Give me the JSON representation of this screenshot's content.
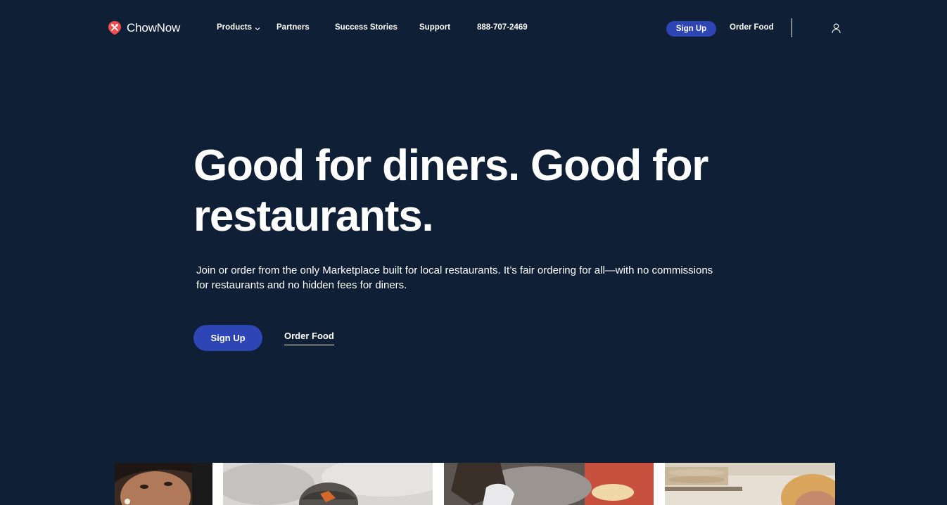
{
  "brand": {
    "name": "ChowNow",
    "accent": "#ef4e4e",
    "primary_button": "#2e45b5",
    "background": "#0f1f35"
  },
  "nav": {
    "products": "Products",
    "partners": "Partners",
    "success_stories": "Success Stories",
    "support": "Support",
    "phone": "888-707-2469",
    "sign_up": "Sign Up",
    "order_food": "Order Food",
    "icons": [
      "chevron-down-icon",
      "user-icon"
    ]
  },
  "hero": {
    "title": "Good for diners. Good for restaurants.",
    "subtitle": "Join or order from the only Marketplace built for local restaurants. It’s fair ordering for all—with no commissions for restaurants and no hidden fees for diners.",
    "sign_up": "Sign Up",
    "order_food": "Order Food"
  },
  "photos": [
    "diner-photo",
    "chef-in-smoke-photo",
    "grill-cooking-photo",
    "kitchen-plates-photo"
  ]
}
